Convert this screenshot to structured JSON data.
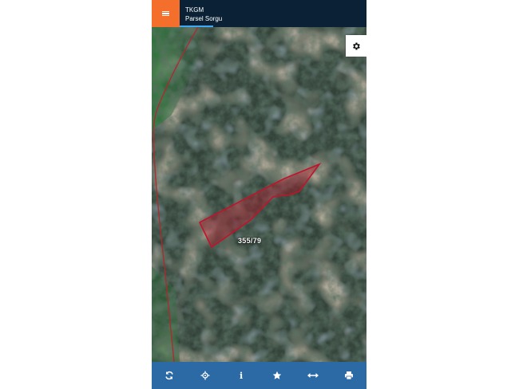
{
  "header": {
    "menu_icon": "hamburger-menu-icon",
    "title": "TKGM",
    "subtitle": "Parsel Sorgu",
    "progress": 0.18,
    "colors": {
      "bar": "#0b2236",
      "menu": "#f36f2b",
      "progress": "#3fa9f5"
    }
  },
  "map": {
    "type": "satellite",
    "parcel": {
      "label": "355/79",
      "stroke": "#c0142a",
      "fill": "#c0142a"
    },
    "settings_icon": "gear-icon"
  },
  "toolbar": {
    "background": "#2b6aa5",
    "buttons": [
      {
        "icon": "refresh-icon"
      },
      {
        "icon": "locate-crosshair-icon"
      },
      {
        "icon": "info-icon"
      },
      {
        "icon": "star-icon"
      },
      {
        "icon": "measure-arrows-icon"
      },
      {
        "icon": "print-icon"
      }
    ]
  }
}
